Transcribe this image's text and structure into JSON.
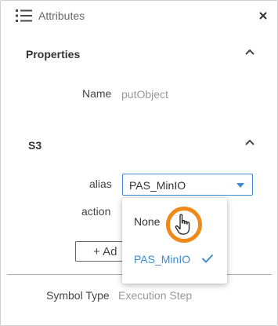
{
  "header": {
    "title": "Attributes",
    "list_icon": "list-icon",
    "close_icon": "close-icon"
  },
  "properties": {
    "title": "Properties",
    "name_label": "Name",
    "name_value": "putObject"
  },
  "s3": {
    "title": "S3",
    "alias_label": "alias",
    "alias_value": "PAS_MinIO",
    "action_label": "action",
    "add_label": "+ Ad"
  },
  "dropdown": {
    "options": [
      {
        "label": "None",
        "selected": false
      },
      {
        "label": "PAS_MinIO",
        "selected": true
      }
    ]
  },
  "footer": {
    "symbol_type_label": "Symbol Type",
    "symbol_type_value": "Execution Step"
  },
  "colors": {
    "accent": "#3d8bd1",
    "highlight_ring": "#ef8a1a"
  }
}
